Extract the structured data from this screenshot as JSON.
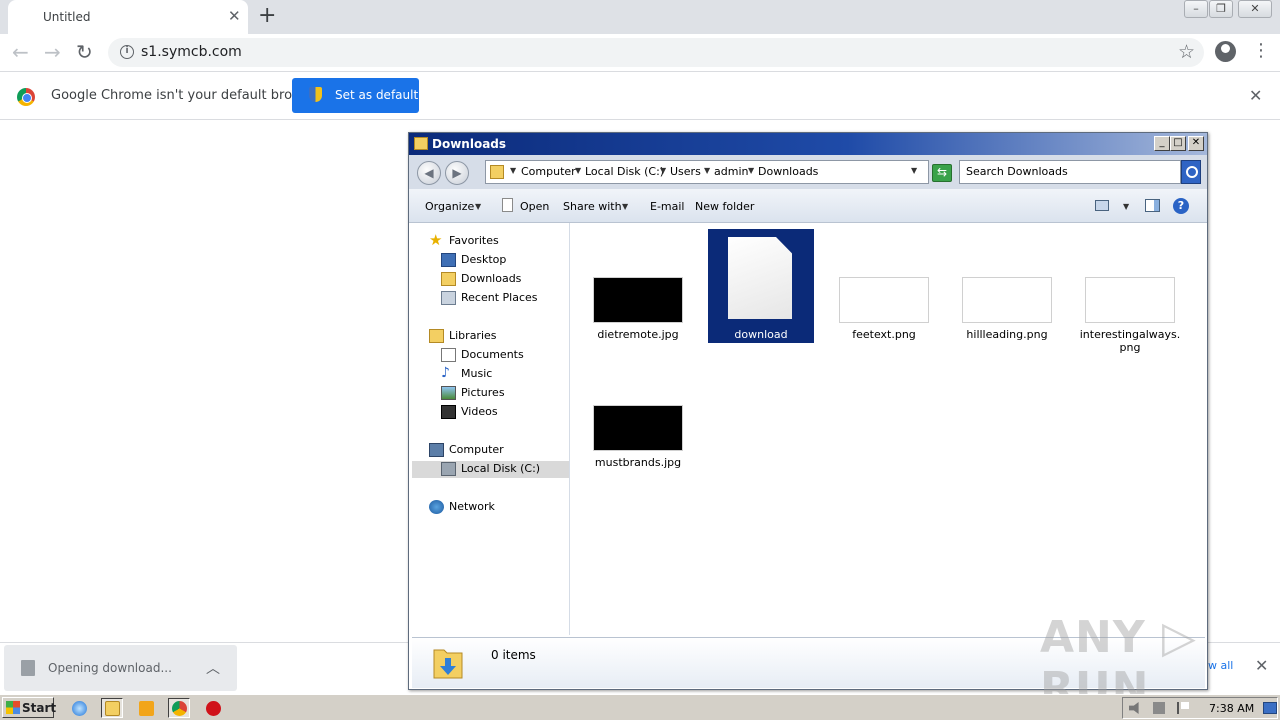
{
  "browser": {
    "tab_title": "Untitled",
    "tab_close": "✕",
    "new_tab": "+",
    "url": "s1.symcb.com",
    "infobar": {
      "message": "Google Chrome isn't your default browser",
      "button": "Set as default",
      "close": "✕"
    }
  },
  "download_shelf": {
    "status": "Opening download...",
    "show_all": "w all",
    "close": "✕"
  },
  "explorer": {
    "title": "Downloads",
    "breadcrumbs": [
      "Computer",
      "Local Disk (C:)",
      "Users",
      "admin",
      "Downloads"
    ],
    "search_placeholder": "Search Downloads",
    "commands": {
      "organize": "Organize",
      "open": "Open",
      "share_with": "Share with",
      "email": "E-mail",
      "new_folder": "New folder"
    },
    "nav": {
      "favorites": "Favorites",
      "desktop": "Desktop",
      "downloads": "Downloads",
      "recent_places": "Recent Places",
      "libraries": "Libraries",
      "documents": "Documents",
      "music": "Music",
      "pictures": "Pictures",
      "videos": "Videos",
      "computer": "Computer",
      "local_disk": "Local Disk (C:)",
      "network": "Network"
    },
    "files": [
      {
        "name": "dietremote.jpg",
        "thumb": "#000000"
      },
      {
        "name": "download",
        "thumb": "document"
      },
      {
        "name": "feetext.png",
        "thumb": "#ffffff"
      },
      {
        "name": "hillleading.png",
        "thumb": "#ffffff"
      },
      {
        "name": "interestingalways.png",
        "thumb": "#ffffff"
      },
      {
        "name": "mustbrands.jpg",
        "thumb": "#000000"
      }
    ],
    "status_count": "0 items"
  },
  "watermark": "ANY RUN",
  "taskbar": {
    "start": "Start",
    "clock": "7:38 AM"
  },
  "colors": {
    "chrome_blue": "#1a73e8",
    "selection_navy": "#0b2a78",
    "explorer_title": "#0b2a7a"
  }
}
